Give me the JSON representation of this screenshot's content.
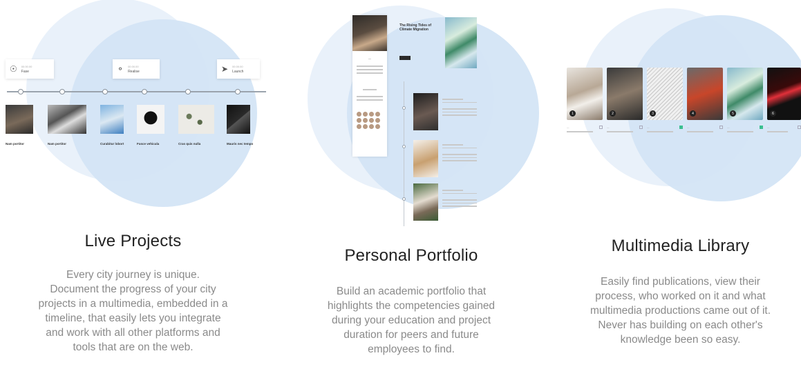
{
  "features": [
    {
      "title": "Live Projects",
      "description_lines": [
        "Every city journey is unique.",
        "Document the progress of your city",
        "projects in a multimedia, embedded in a",
        "timeline, that easily lets you integrate",
        "and work with all other platforms and",
        "tools that are on the web."
      ],
      "milestones": [
        {
          "date": "00.00.00",
          "label": "Fase",
          "icon": "lightbulb-icon"
        },
        {
          "date": "00.00.00",
          "label": "Realise",
          "icon": "balloon-icon"
        },
        {
          "date": "00.00.00",
          "label": "Launch",
          "icon": "paper-plane-icon"
        }
      ],
      "timeline_cards": [
        {
          "caption": "Nam portitor"
        },
        {
          "caption": "Nam portitor"
        },
        {
          "caption": "Curabitur lobort"
        },
        {
          "caption": "Fusce vehicula"
        },
        {
          "caption": "Cras quis nulla"
        },
        {
          "caption": "Mauris nec tempo"
        }
      ]
    },
    {
      "title": "Personal Portfolio",
      "description_lines": [
        "Build an academic portfolio that",
        "highlights the competencies gained",
        "during your education and project",
        "duration for peers and future",
        "employees to find."
      ],
      "article_title": "The Rising Tides of Climate Migration"
    },
    {
      "title": "Multimedia Library",
      "description_lines": [
        "Easily find publications, view their",
        "process, who worked on it and what",
        "multimedia productions came out of it.",
        "Never has building on each other's",
        "knowledge been so easy."
      ],
      "library_items": [
        {
          "num": "1"
        },
        {
          "num": "2"
        },
        {
          "num": "3"
        },
        {
          "num": "4"
        },
        {
          "num": "5"
        },
        {
          "num": "6"
        }
      ]
    }
  ],
  "colors": {
    "circle_light": "#e9f1fa",
    "circle_mid": "#d3e4f5",
    "title": "#222222",
    "description": "#8a8a8a",
    "accent_green": "#3bbf8f"
  }
}
